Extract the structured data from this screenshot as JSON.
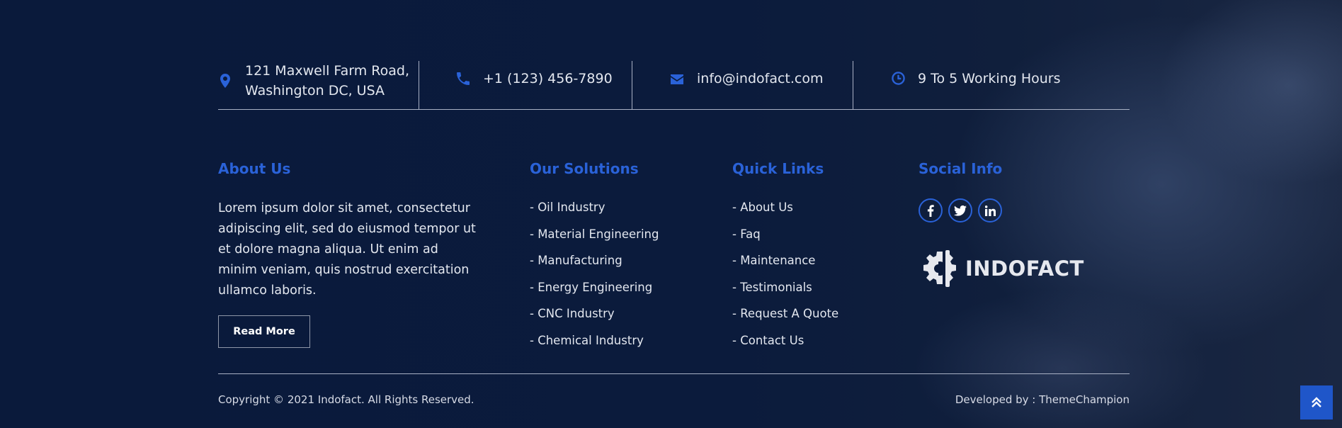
{
  "contact": {
    "address_line1": "121 Maxwell Farm Road,",
    "address_line2": "Washington DC, USA",
    "phone": "+1 (123) 456-7890",
    "email": "info@indofact.com",
    "hours": "9 To 5 Working Hours"
  },
  "about": {
    "title": "About Us",
    "text": "Lorem ipsum dolor sit amet, consectetur adipiscing elit, sed do eiusmod tempor ut et dolore magna aliqua. Ut enim ad minim veniam, quis nostrud exercitation ullamco laboris.",
    "button_label": "Read More"
  },
  "solutions": {
    "title": "Our Solutions",
    "items": [
      "- Oil Industry",
      "- Material Engineering",
      "- Manufacturing",
      "- Energy Engineering",
      "- CNC Industry",
      "- Chemical Industry"
    ]
  },
  "quick_links": {
    "title": "Quick Links",
    "items": [
      "- About Us",
      "- Faq",
      "- Maintenance",
      "- Testimonials",
      "- Request A Quote",
      "- Contact Us"
    ]
  },
  "social": {
    "title": "Social Info",
    "icons": [
      "facebook-icon",
      "twitter-icon",
      "linkedin-icon"
    ],
    "logo_text": "INDOFACT"
  },
  "footer": {
    "copyright": "Copyright © 2021 Indofact. All Rights Reserved.",
    "developer": "Developed by : ThemeChampion"
  },
  "colors": {
    "background": "#0b1a3a",
    "accent": "#2a62d8",
    "text": "#e3e7ef"
  }
}
